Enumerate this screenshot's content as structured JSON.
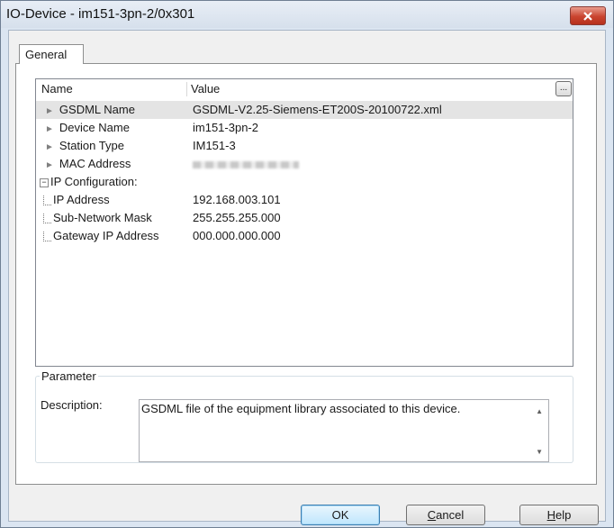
{
  "window": {
    "title": "IO-Device - im151-3pn-2/0x301"
  },
  "tabs": [
    {
      "label": "General"
    }
  ],
  "grid": {
    "headers": {
      "name": "Name",
      "value": "Value"
    },
    "rows": [
      {
        "name": "GSDML Name",
        "value": "GSDML-V2.25-Siemens-ET200S-20100722.xml"
      },
      {
        "name": "Device Name",
        "value": "im151-3pn-2"
      },
      {
        "name": "Station Type",
        "value": "IM151-3"
      },
      {
        "name": "MAC Address",
        "value": ""
      },
      {
        "name": "IP Configuration:",
        "value": ""
      },
      {
        "name": "IP Address",
        "value": "192.168.003.101"
      },
      {
        "name": "Sub-Network Mask",
        "value": "255.255.255.000"
      },
      {
        "name": "Gateway IP Address",
        "value": "000.000.000.000"
      }
    ],
    "ellipsis": "..."
  },
  "parameter": {
    "legend": "Parameter",
    "desc_label": "Description:",
    "desc_text": "GSDML file of the equipment library associated to this device."
  },
  "buttons": {
    "ok": "OK",
    "cancel_first": "C",
    "cancel_rest": "ancel",
    "help_first": "H",
    "help_rest": "elp"
  },
  "colors": {
    "close": "#c9442f",
    "ok_border": "#3c7fb1"
  }
}
